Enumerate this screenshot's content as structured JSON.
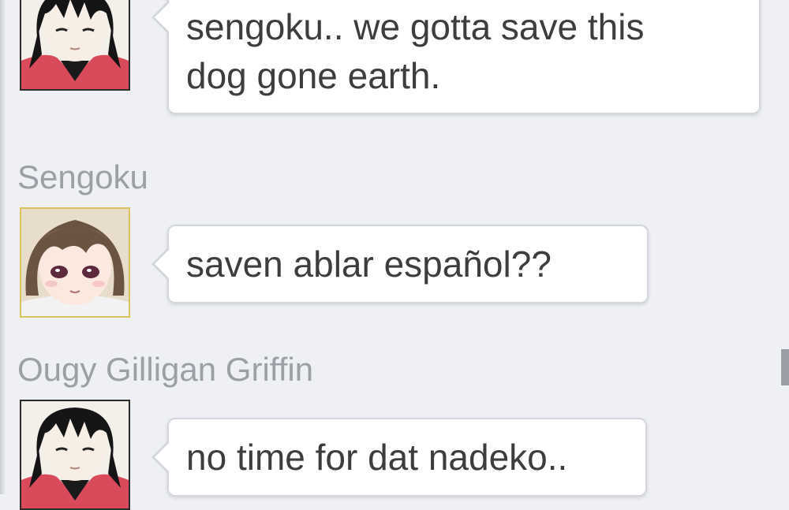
{
  "messages": [
    {
      "sender": "",
      "avatar": "dark-haired-character-avatar-icon",
      "lines": [
        "sengoku.. we gotta save this",
        "dog gone earth."
      ]
    },
    {
      "sender": "Sengoku",
      "avatar": "brown-haired-girl-avatar-icon",
      "lines": [
        "saven ablar español??"
      ]
    },
    {
      "sender": "Ougy Gilligan Griffin",
      "avatar": "dark-haired-character-avatar-icon",
      "lines": [
        "no time for dat nadeko.."
      ]
    }
  ],
  "colors": {
    "background": "#eef0f4",
    "bubble": "#ffffff",
    "bubble_border": "#d3d6dc",
    "message_text": "#3d3d3d",
    "sender_name": "#9c9fa5"
  }
}
